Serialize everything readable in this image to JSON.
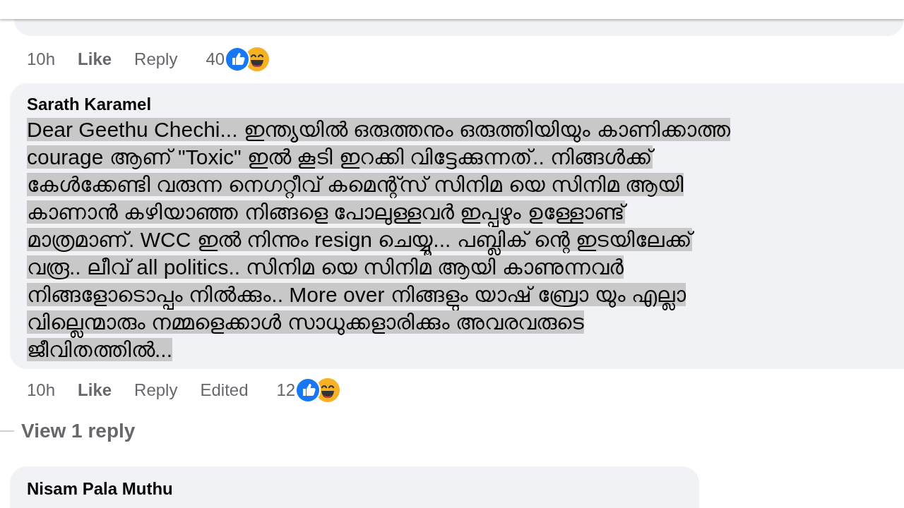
{
  "comments": [
    {
      "kind": "cut_top",
      "meta": {
        "time": "10h",
        "like": "Like",
        "reply": "Reply",
        "count": "40"
      }
    },
    {
      "kind": "full",
      "author": "Sarath Karamel",
      "lines": [
        "Dear Geethu Chechi... ഇന്ത്യയിൽ ഒരുത്തനും ഒരുത്തിയിയും കാണിക്കാത്ത",
        "courage ആണ് \"Toxic\" ഇൽ കൂടി ഇറക്കി വിട്ടേക്കുന്നത്.. നിങ്ങൾക്ക്",
        "കേൾക്കേണ്ടി വരുന്ന നെഗറ്റീവ് കമെന്റ്സ് സിനിമ യെ സിനിമ ആയി",
        "കാണാൻ കഴിയാഞ്ഞ നിങ്ങളെ പോലുള്ളവർ ഇപ്പഴും ഉള്ളോണ്ട്",
        "മാത്രമാണ്. WCC ഇൽ നിന്നും resign ചെയ്യൂ... പബ്ലിക് ന്റെ ഇടയിലേക്ക്",
        "വരൂ.. ലീവ് all politics.. സിനിമ യെ സിനിമ ആയി കാണുന്നവർ",
        "നിങ്ങളോടൊപ്പം നിൽക്കും.. More over നിങ്ങളും യാഷ് ബ്രോ യും എല്ലാ",
        "വില്ലെന്മാരും നമ്മളെക്കാൾ സാധുക്കളാരിക്കും അവരവരുടെ",
        "ജീവിതത്തിൽ..."
      ],
      "highlighted": true,
      "meta": {
        "time": "10h",
        "like": "Like",
        "reply": "Reply",
        "edited": "Edited",
        "count": "12"
      },
      "view_replies": "View 1 reply"
    },
    {
      "kind": "cut_bottom",
      "author": "Nisam Pala Muthu"
    }
  ]
}
